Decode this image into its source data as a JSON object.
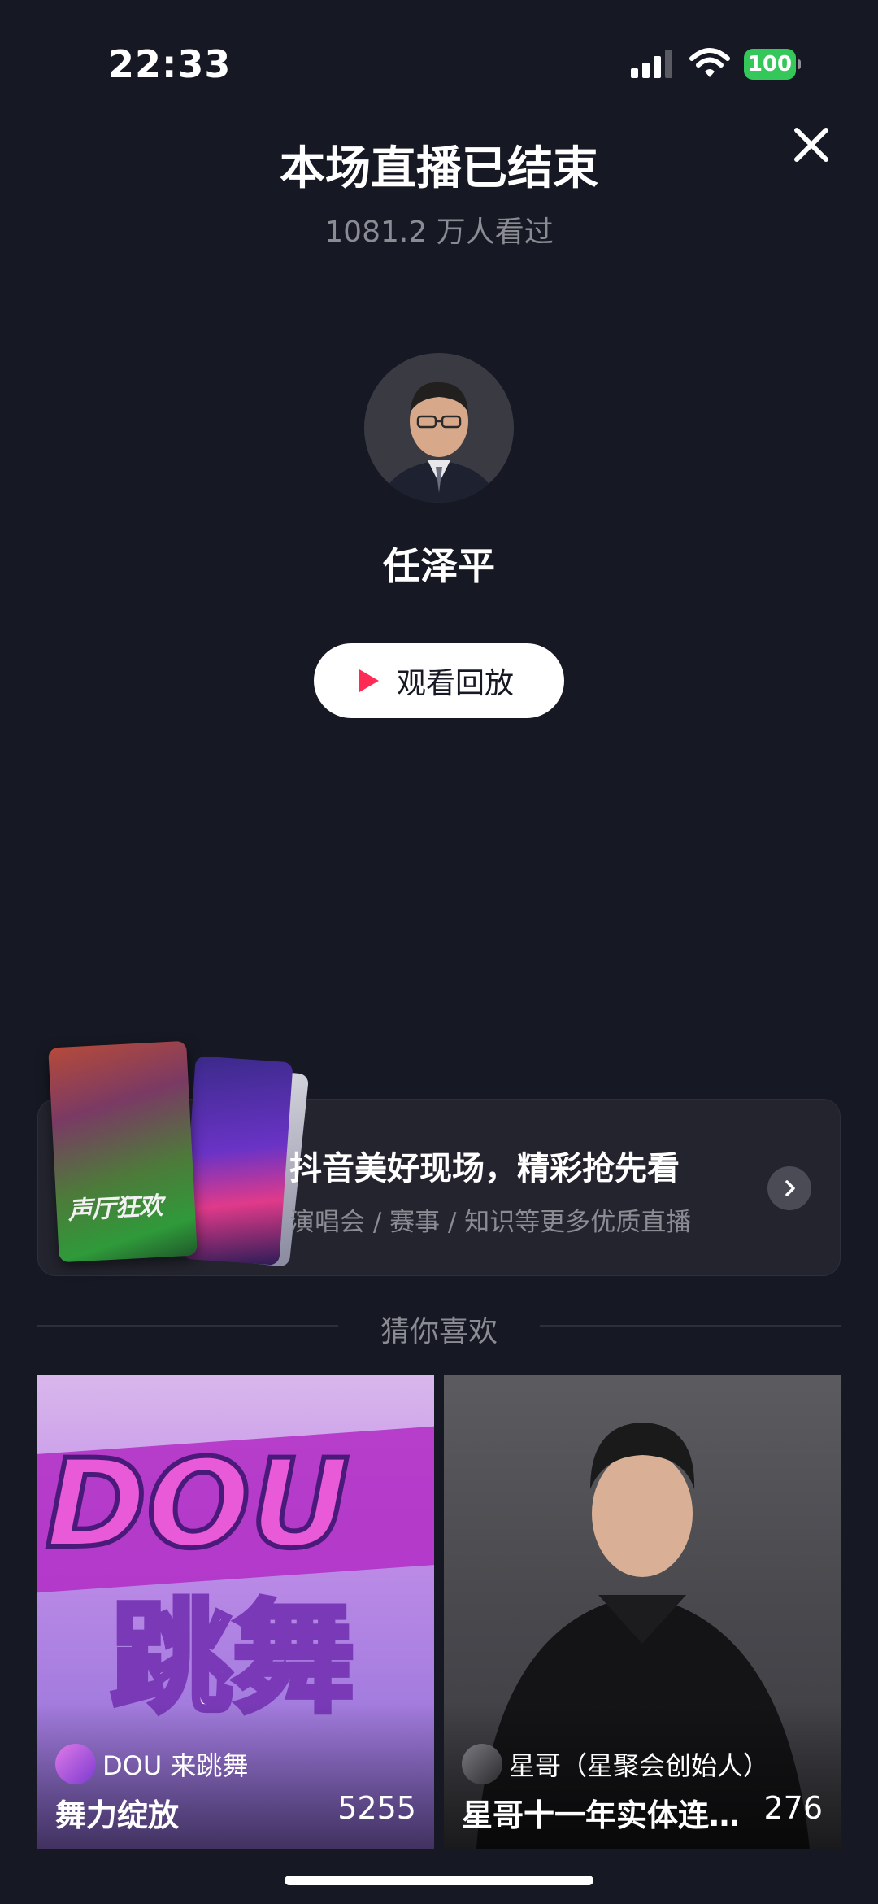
{
  "status_bar": {
    "time": "22:33",
    "battery": "100"
  },
  "header": {
    "title": "本场直播已结束",
    "viewers": "1081.2 万人看过"
  },
  "host": {
    "name": "任泽平"
  },
  "actions": {
    "replay_label": "观看回放"
  },
  "promo": {
    "title": "抖音美好现场，精彩抢先看",
    "subtitle": "演唱会 / 赛事 / 知识等更多优质直播",
    "card_text": "声厅狂欢"
  },
  "section": {
    "label": "猜你喜欢"
  },
  "recommendations": [
    {
      "author": "DOU 来跳舞",
      "title": "舞力绽放",
      "count": "5255",
      "cover_text": "跳舞"
    },
    {
      "author": "星哥（星聚会创始人）",
      "title": "星哥十一年实体连…",
      "count": "276"
    }
  ],
  "colors": {
    "background": "#161823",
    "accent": "#fe2c55",
    "battery": "#34c759"
  }
}
